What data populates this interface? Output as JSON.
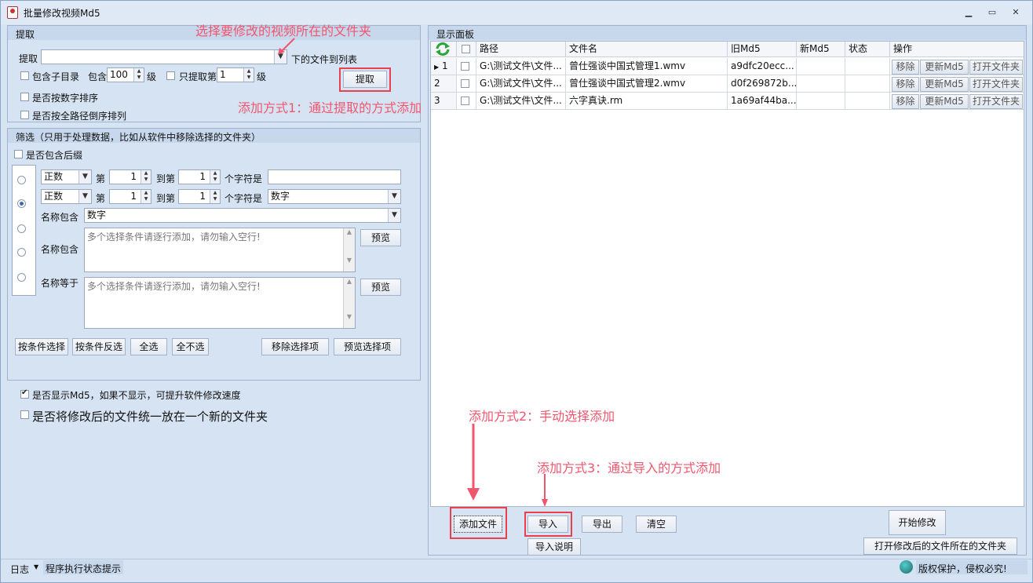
{
  "window": {
    "title": "批量修改视频Md5",
    "minimize": "▁",
    "restore": "▭",
    "close": "✕"
  },
  "extract": {
    "group_title": "提取",
    "label": "提取",
    "path_value": "",
    "suffix": "下的文件到列表",
    "include_subdirs": "包含子目录",
    "include_label": "包含",
    "include_level": "100",
    "level_unit": "级",
    "only_extract_label": "只提取第",
    "only_level": "1",
    "only_level_unit": "级",
    "numeric_sort": "是否按数字排序",
    "fullpath_reverse": "是否按全路径倒序排列",
    "extract_button": "提取"
  },
  "filter": {
    "group_title": "筛选（只用于处理数据，比如从软件中移除选择的文件夹）",
    "include_suffix": "是否包含后缀",
    "row1": {
      "mode": "正数",
      "di": "第",
      "from": "1",
      "to_label": "到第",
      "to": "1",
      "chars_label": "个字符是",
      "value": ""
    },
    "row2": {
      "mode": "正数",
      "di": "第",
      "from": "1",
      "to_label": "到第",
      "to": "1",
      "chars_label": "个字符是",
      "value": "数字"
    },
    "name_contains_label": "名称包含",
    "name_contains_value": "数字",
    "name_contains2_label": "名称包含",
    "textarea_placeholder": "多个选择条件请逐行添加，请勿输入空行!",
    "preview": "预览",
    "name_equals_label": "名称等于",
    "textarea2_placeholder": "多个选择条件请逐行添加，请勿输入空行!",
    "preview2": "预览",
    "btn_select": "按条件选择",
    "btn_invert": "按条件反选",
    "btn_all": "全选",
    "btn_none": "全不选",
    "btn_remove": "移除选择项",
    "btn_preview_sel": "预览选择项"
  },
  "options": {
    "show_md5": "是否显示Md5，如果不显示，可提升软件修改速度",
    "new_folder": "是否将修改后的文件统一放在一个新的文件夹"
  },
  "panel": {
    "group_title": "显示面板",
    "columns": [
      "路径",
      "文件名",
      "旧Md5",
      "新Md5",
      "状态",
      "操作"
    ],
    "rows": [
      {
        "num": "1",
        "path": "G:\\测试文件\\文件...",
        "name": "曾仕强谈中国式管理1.wmv",
        "old": "a9dfc20ecc...",
        "new": "",
        "status": ""
      },
      {
        "num": "2",
        "path": "G:\\测试文件\\文件...",
        "name": "曾仕强谈中国式管理2.wmv",
        "old": "d0f269872b...",
        "new": "",
        "status": ""
      },
      {
        "num": "3",
        "path": "G:\\测试文件\\文件...",
        "name": "六字真诀.rm",
        "old": "1a69af44ba...",
        "new": "",
        "status": ""
      }
    ],
    "row_actions": [
      "移除",
      "更新Md5",
      "打开文件夹"
    ]
  },
  "bottom": {
    "add_file": "添加文件",
    "import": "导入",
    "export": "导出",
    "clear": "清空",
    "import_help": "导入说明",
    "start": "开始修改",
    "open_folder": "打开修改后的文件所在的文件夹"
  },
  "annotations": {
    "select_folder": "选择要修改的视频所在的文件夹",
    "method1": "添加方式1：通过提取的方式添加",
    "method2": "添加方式2：手动选择添加",
    "method3": "添加方式3：通过导入的方式添加"
  },
  "statusbar": {
    "log": "日志",
    "hint": "程序执行状态提示",
    "copyright": "版权保护，侵权必究!"
  },
  "colors": {
    "annotation": "#f0566e",
    "panel_bg": "#d6e3f2"
  }
}
